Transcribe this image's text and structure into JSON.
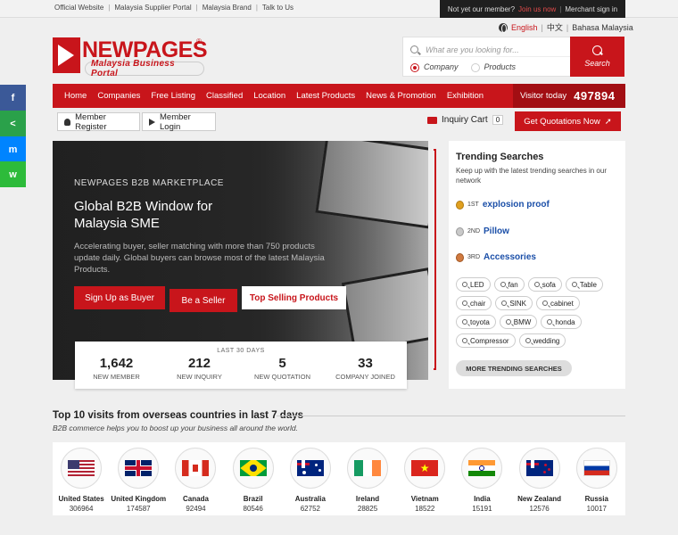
{
  "topbar": {
    "links": [
      "Official Website",
      "Malaysia Supplier Portal",
      "Malaysia Brand",
      "Talk to Us"
    ],
    "member_prompt": "Not yet our member?",
    "join_label": "Join us now",
    "signin_label": "Merchant sign in"
  },
  "lang": {
    "english": "English",
    "chinese": "中文",
    "malay": "Bahasa Malaysia"
  },
  "logo": {
    "name": "NEWPAGES",
    "reg": "®",
    "tagline": "Malaysia Business Portal"
  },
  "search": {
    "placeholder": "What are you looking for...",
    "option_company": "Company",
    "option_products": "Products",
    "button": "Search"
  },
  "nav": {
    "items": [
      "Home",
      "Companies",
      "Free Listing",
      "Classified",
      "Location",
      "Latest Products",
      "News & Promotion",
      "Exhibition"
    ],
    "visitor_label": "Visitor today",
    "visitor_count": "497894"
  },
  "member": {
    "register": "Member Register",
    "login": "Member Login",
    "cart": "Inquiry Cart",
    "cart_count": "0",
    "quote": "Get Quotations Now"
  },
  "hero": {
    "kicker": "NEWPAGES B2B MARKETPLACE",
    "title": "Global B2B Window for Malaysia SME",
    "desc": "Accelerating buyer, seller matching with more than 750 products update daily. Global buyers can browse most of the latest Malaysia Products.",
    "btn_buyer": "Sign Up as Buyer",
    "btn_seller": "Be a Seller",
    "btn_top": "Top Selling Products"
  },
  "stats": {
    "label": "LAST 30 DAYS",
    "items": [
      {
        "value": "1,642",
        "label": "NEW MEMBER"
      },
      {
        "value": "212",
        "label": "NEW INQUIRY"
      },
      {
        "value": "5",
        "label": "NEW QUOTATION"
      },
      {
        "value": "33",
        "label": "COMPANY JOINED"
      }
    ]
  },
  "trending": {
    "title": "Trending Searches",
    "subtitle": "Keep up with the latest trending searches in our network",
    "ranks": [
      {
        "rank": "1ST",
        "term": "explosion proof"
      },
      {
        "rank": "2ND",
        "term": "Pillow"
      },
      {
        "rank": "3RD",
        "term": "Accessories"
      }
    ],
    "tags": [
      "LED",
      "fan",
      "sofa",
      "Table",
      "chair",
      "SINK",
      "cabinet",
      "toyota",
      "BMW",
      "honda",
      "Compressor",
      "wedding"
    ],
    "more": "MORE TRENDING SEARCHES"
  },
  "top10": {
    "title": "Top 10 visits from overseas countries in last 7 days",
    "subtitle": "B2B commerce helps you to boost up your business all around the world.",
    "countries": [
      {
        "name": "United States",
        "count": "306964"
      },
      {
        "name": "United Kingdom",
        "count": "174587"
      },
      {
        "name": "Canada",
        "count": "92494"
      },
      {
        "name": "Brazil",
        "count": "80546"
      },
      {
        "name": "Australia",
        "count": "62752"
      },
      {
        "name": "Ireland",
        "count": "28825"
      },
      {
        "name": "Vietnam",
        "count": "18522"
      },
      {
        "name": "India",
        "count": "15191"
      },
      {
        "name": "New Zealand",
        "count": "12576"
      },
      {
        "name": "Russia",
        "count": "10017"
      }
    ]
  },
  "share": {
    "facebook": "f",
    "share": "<",
    "messenger": "m",
    "wechat": "w"
  },
  "colors": {
    "brand": "#c8151b",
    "link": "#1b4fa8"
  }
}
